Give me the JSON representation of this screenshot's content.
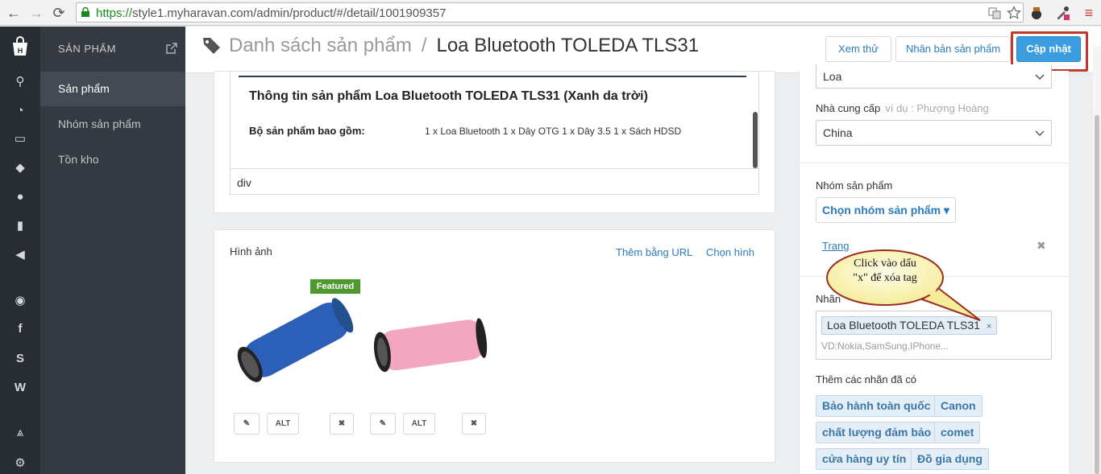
{
  "browser": {
    "url_scheme": "https://",
    "url_rest": "style1.myharavan.com/admin/product/#/detail/1001909357"
  },
  "sidebar": {
    "section_title": "SẢN PHẨM",
    "items": [
      {
        "label": "Sản phẩm",
        "active": true
      },
      {
        "label": "Nhóm sản phẩm",
        "active": false
      },
      {
        "label": "Tồn kho",
        "active": false
      }
    ]
  },
  "header": {
    "breadcrumb_parent": "Danh sách sản phẩm",
    "separator": "/",
    "breadcrumb_current": "Loa Bluetooth TOLEDA TLS31",
    "preview_label": "Xem thử",
    "duplicate_label": "Nhân bản sản phẩm",
    "update_label": "Cập nhật"
  },
  "description": {
    "heading": "Thông tin sản phẩm Loa Bluetooth TOLEDA TLS31 (Xanh da trời)",
    "bundle_label": "Bộ sản phẩm bao gồm:",
    "bundle_value": "1 x Loa Bluetooth  1 x Dây OTG  1 x Dây 3.5  1 x Sách HDSD",
    "element_path": "div"
  },
  "images": {
    "title": "Hình ảnh",
    "add_url_label": "Thêm bằng URL",
    "choose_label": "Chọn hình",
    "featured_label": "Featured",
    "alt_label": "ALT"
  },
  "sidebar_right": {
    "type_value": "Loa",
    "vendor_label": "Nhà cung cấp",
    "vendor_hint": "ví dụ : Phượng Hoàng",
    "vendor_value": "China",
    "collection_label": "Nhóm sản phẩm",
    "collection_button": "Chọn nhóm sản phẩm ▾",
    "collection_link": "Trang",
    "tags_label": "Nhãn",
    "tag_chip": "Loa Bluetooth TOLEDA TLS31",
    "tag_remove": "×",
    "tags_placeholder": "VD:Nokia,SamSung,IPhone...",
    "existing_tags_label": "Thêm các nhãn đã có",
    "existing_tags": [
      "Bảo hành toàn quốc",
      "Canon",
      "chất lượng đảm bảo",
      "comet",
      "cửa hàng uy tín",
      "Đồ gia dụng"
    ]
  },
  "annotation": {
    "callout_line1": "Click vào dấu",
    "callout_line2": "\"x\" để xóa tag"
  },
  "colors": {
    "primary": "#3c9ce0",
    "highlight": "#c0392b",
    "featured": "#4e9a2f",
    "sidebar_dark": "#282c33"
  }
}
